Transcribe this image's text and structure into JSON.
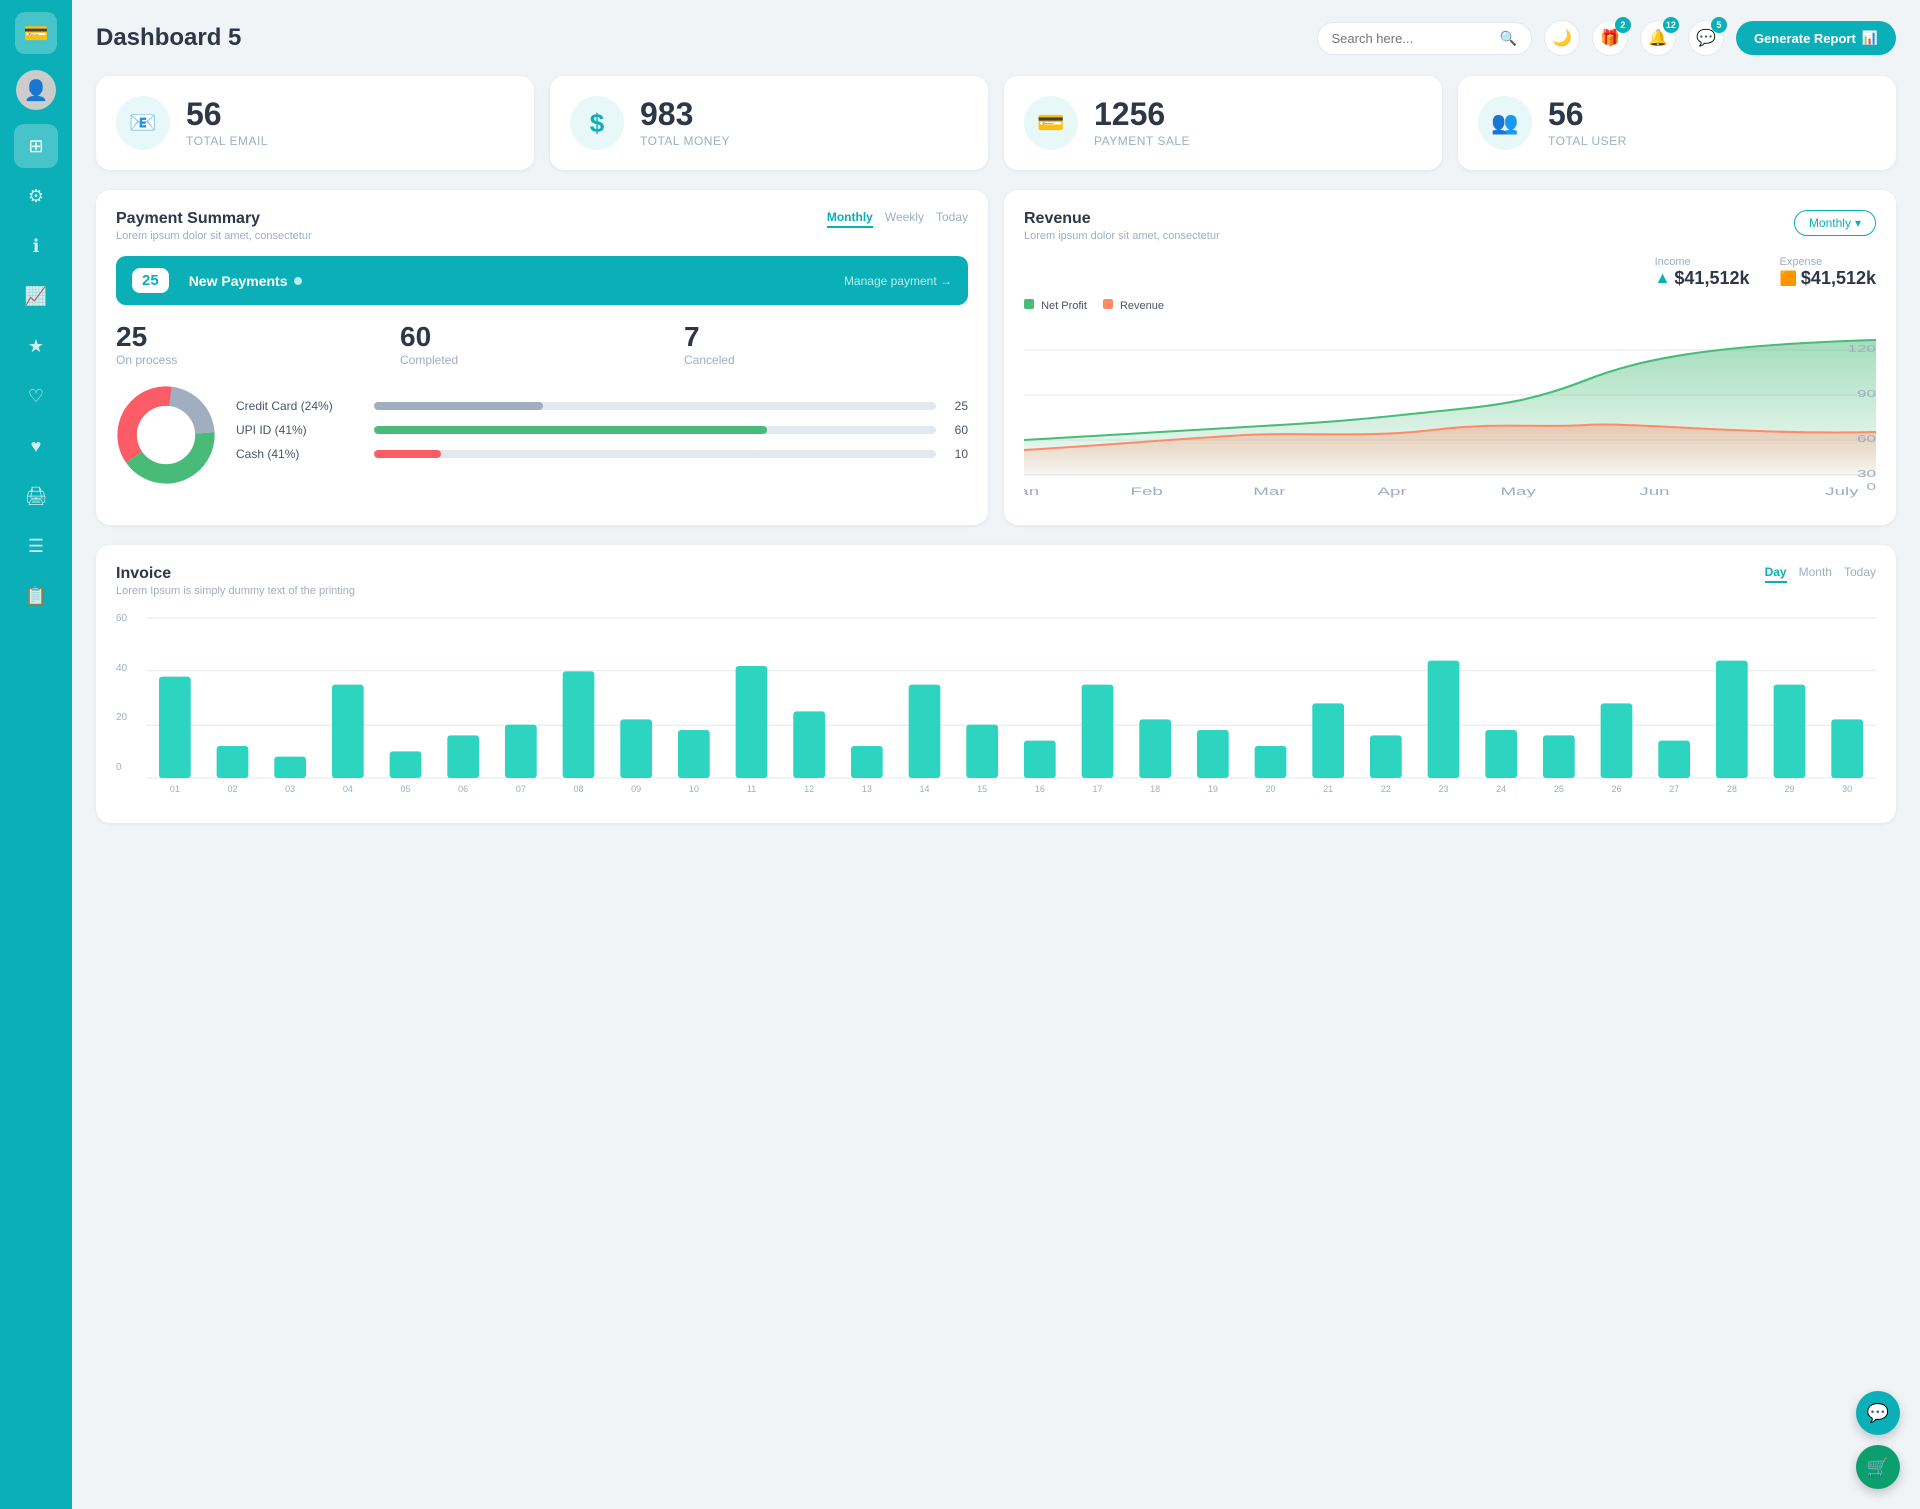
{
  "app": {
    "title": "Dashboard 5",
    "logo_icon": "💳"
  },
  "sidebar": {
    "items": [
      {
        "name": "dashboard",
        "icon": "⊞",
        "active": true
      },
      {
        "name": "settings",
        "icon": "⚙"
      },
      {
        "name": "info",
        "icon": "ℹ"
      },
      {
        "name": "chart",
        "icon": "📊"
      },
      {
        "name": "star",
        "icon": "★"
      },
      {
        "name": "heart-outline",
        "icon": "♡"
      },
      {
        "name": "heart",
        "icon": "♥"
      },
      {
        "name": "print",
        "icon": "🖨"
      },
      {
        "name": "list",
        "icon": "☰"
      },
      {
        "name": "document",
        "icon": "📋"
      }
    ]
  },
  "header": {
    "title": "Dashboard 5",
    "search_placeholder": "Search here...",
    "generate_label": "Generate Report",
    "icons": [
      {
        "name": "moon",
        "symbol": "🌙"
      },
      {
        "name": "gift",
        "symbol": "🎁",
        "badge": "2"
      },
      {
        "name": "bell",
        "symbol": "🔔",
        "badge": "12"
      },
      {
        "name": "chat",
        "symbol": "💬",
        "badge": "5"
      }
    ]
  },
  "stats": [
    {
      "num": "56",
      "label": "TOTAL EMAIL",
      "icon": "📧"
    },
    {
      "num": "983",
      "label": "TOTAL MONEY",
      "icon": "$"
    },
    {
      "num": "1256",
      "label": "PAYMENT SALE",
      "icon": "💳"
    },
    {
      "num": "56",
      "label": "TOTAL USER",
      "icon": "👥"
    }
  ],
  "payment_summary": {
    "title": "Payment Summary",
    "subtitle": "Lorem ipsum dolor sit amet, consectetur",
    "tabs": [
      "Monthly",
      "Weekly",
      "Today"
    ],
    "active_tab": "Monthly",
    "new_payments_count": "25",
    "new_payments_label": "New Payments",
    "manage_link": "Manage payment →",
    "stats": [
      {
        "num": "25",
        "label": "On process"
      },
      {
        "num": "60",
        "label": "Completed"
      },
      {
        "num": "7",
        "label": "Canceled"
      }
    ],
    "bars": [
      {
        "label": "Credit Card (24%)",
        "pct": 24,
        "color": "#a0aec0",
        "val": "25"
      },
      {
        "label": "UPI ID (41%)",
        "pct": 70,
        "color": "#48bb78",
        "val": "60"
      },
      {
        "label": "Cash (41%)",
        "pct": 12,
        "color": "#fc5c65",
        "val": "10"
      }
    ],
    "donut": {
      "segments": [
        {
          "pct": 24,
          "color": "#a0aec0"
        },
        {
          "pct": 41,
          "color": "#48bb78"
        },
        {
          "pct": 35,
          "color": "#fc5c65"
        }
      ]
    }
  },
  "revenue": {
    "title": "Revenue",
    "subtitle": "Lorem ipsum dolor sit amet, consectetur",
    "monthly_label": "Monthly",
    "income_label": "Income",
    "income_val": "$41,512k",
    "expense_label": "Expense",
    "expense_val": "$41,512k",
    "legend": [
      {
        "label": "Net Profit",
        "color": "#48bb78"
      },
      {
        "label": "Revenue",
        "color": "#fc8c69"
      }
    ],
    "x_labels": [
      "Jan",
      "Feb",
      "Mar",
      "Apr",
      "May",
      "Jun",
      "July"
    ],
    "y_labels": [
      "120",
      "90",
      "60",
      "30",
      "0"
    ]
  },
  "invoice": {
    "title": "Invoice",
    "subtitle": "Lorem Ipsum is simply dummy text of the printing",
    "tabs": [
      "Day",
      "Month",
      "Today"
    ],
    "active_tab": "Day",
    "y_labels": [
      "60",
      "40",
      "20",
      "0"
    ],
    "x_labels": [
      "01",
      "02",
      "03",
      "04",
      "05",
      "06",
      "07",
      "08",
      "09",
      "10",
      "11",
      "12",
      "13",
      "14",
      "15",
      "16",
      "17",
      "18",
      "19",
      "20",
      "21",
      "22",
      "23",
      "24",
      "25",
      "26",
      "27",
      "28",
      "29",
      "30"
    ],
    "bars": [
      38,
      12,
      8,
      35,
      10,
      16,
      20,
      40,
      22,
      18,
      42,
      25,
      12,
      35,
      20,
      14,
      35,
      22,
      18,
      12,
      28,
      16,
      44,
      18,
      16,
      28,
      14,
      44,
      35,
      22
    ]
  },
  "fab": [
    {
      "name": "chat-fab",
      "icon": "💬",
      "color": "#0aafb8"
    },
    {
      "name": "cart-fab",
      "icon": "🛒",
      "color": "#0d9e6e"
    }
  ]
}
